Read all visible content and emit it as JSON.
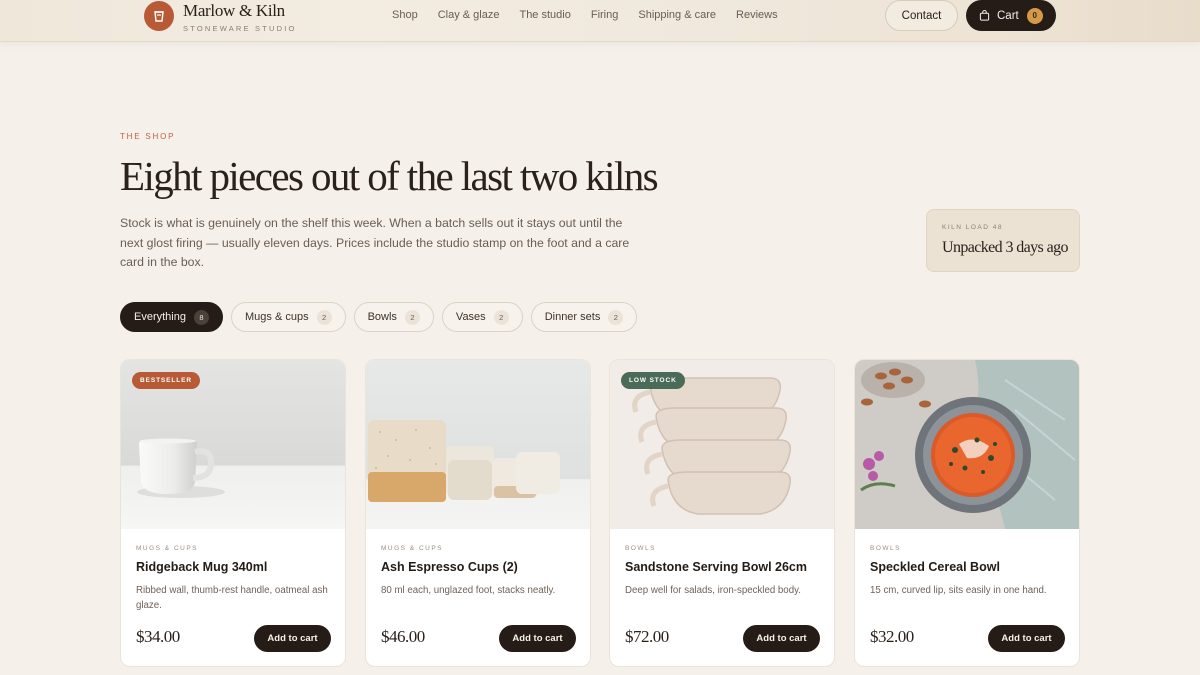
{
  "brand": {
    "name": "Marlow & Kiln",
    "tagline": "STONEWARE STUDIO",
    "logo_icon": "cup-icon",
    "accent": "#b85a36"
  },
  "nav": {
    "items": [
      "Shop",
      "Clay & glaze",
      "The studio",
      "Firing",
      "Shipping & care",
      "Reviews"
    ]
  },
  "header": {
    "contact_label": "Contact",
    "cart_label": "Cart",
    "cart_count": "0",
    "cart_icon": "bag-icon"
  },
  "hero": {
    "eyebrow": "THE SHOP",
    "title": "Eight pieces out of the last two kilns",
    "description": "Stock is what is genuinely on the shelf this week. When a batch sells out it stays out until the next glost firing — usually eleven days. Prices include the studio stamp on the foot and a care card in the box."
  },
  "kiln": {
    "label": "KILN LOAD 48",
    "value": "Unpacked 3 days ago"
  },
  "filters": [
    {
      "label": "Everything",
      "count": "8",
      "active": true
    },
    {
      "label": "Mugs & cups",
      "count": "2",
      "active": false
    },
    {
      "label": "Bowls",
      "count": "2",
      "active": false
    },
    {
      "label": "Vases",
      "count": "2",
      "active": false
    },
    {
      "label": "Dinner sets",
      "count": "2",
      "active": false
    }
  ],
  "products": [
    {
      "badge": "BESTSELLER",
      "badge_color": "#b85a36",
      "category": "MUGS & CUPS",
      "name": "Ridgeback Mug 340ml",
      "description": "Ribbed wall, thumb-rest handle, oatmeal ash glaze.",
      "price": "$34.00",
      "cta": "Add to cart"
    },
    {
      "badge": "",
      "badge_color": "",
      "category": "MUGS & CUPS",
      "name": "Ash Espresso Cups (2)",
      "description": "80 ml each, unglazed foot, stacks neatly.",
      "price": "$46.00",
      "cta": "Add to cart"
    },
    {
      "badge": "LOW STOCK",
      "badge_color": "#4a6b58",
      "category": "BOWLS",
      "name": "Sandstone Serving Bowl 26cm",
      "description": "Deep well for salads, iron-speckled body.",
      "price": "$72.00",
      "cta": "Add to cart"
    },
    {
      "badge": "",
      "badge_color": "",
      "category": "BOWLS",
      "name": "Speckled Cereal Bowl",
      "description": "15 cm, curved lip, sits easily in one hand.",
      "price": "$32.00",
      "cta": "Add to cart"
    }
  ]
}
